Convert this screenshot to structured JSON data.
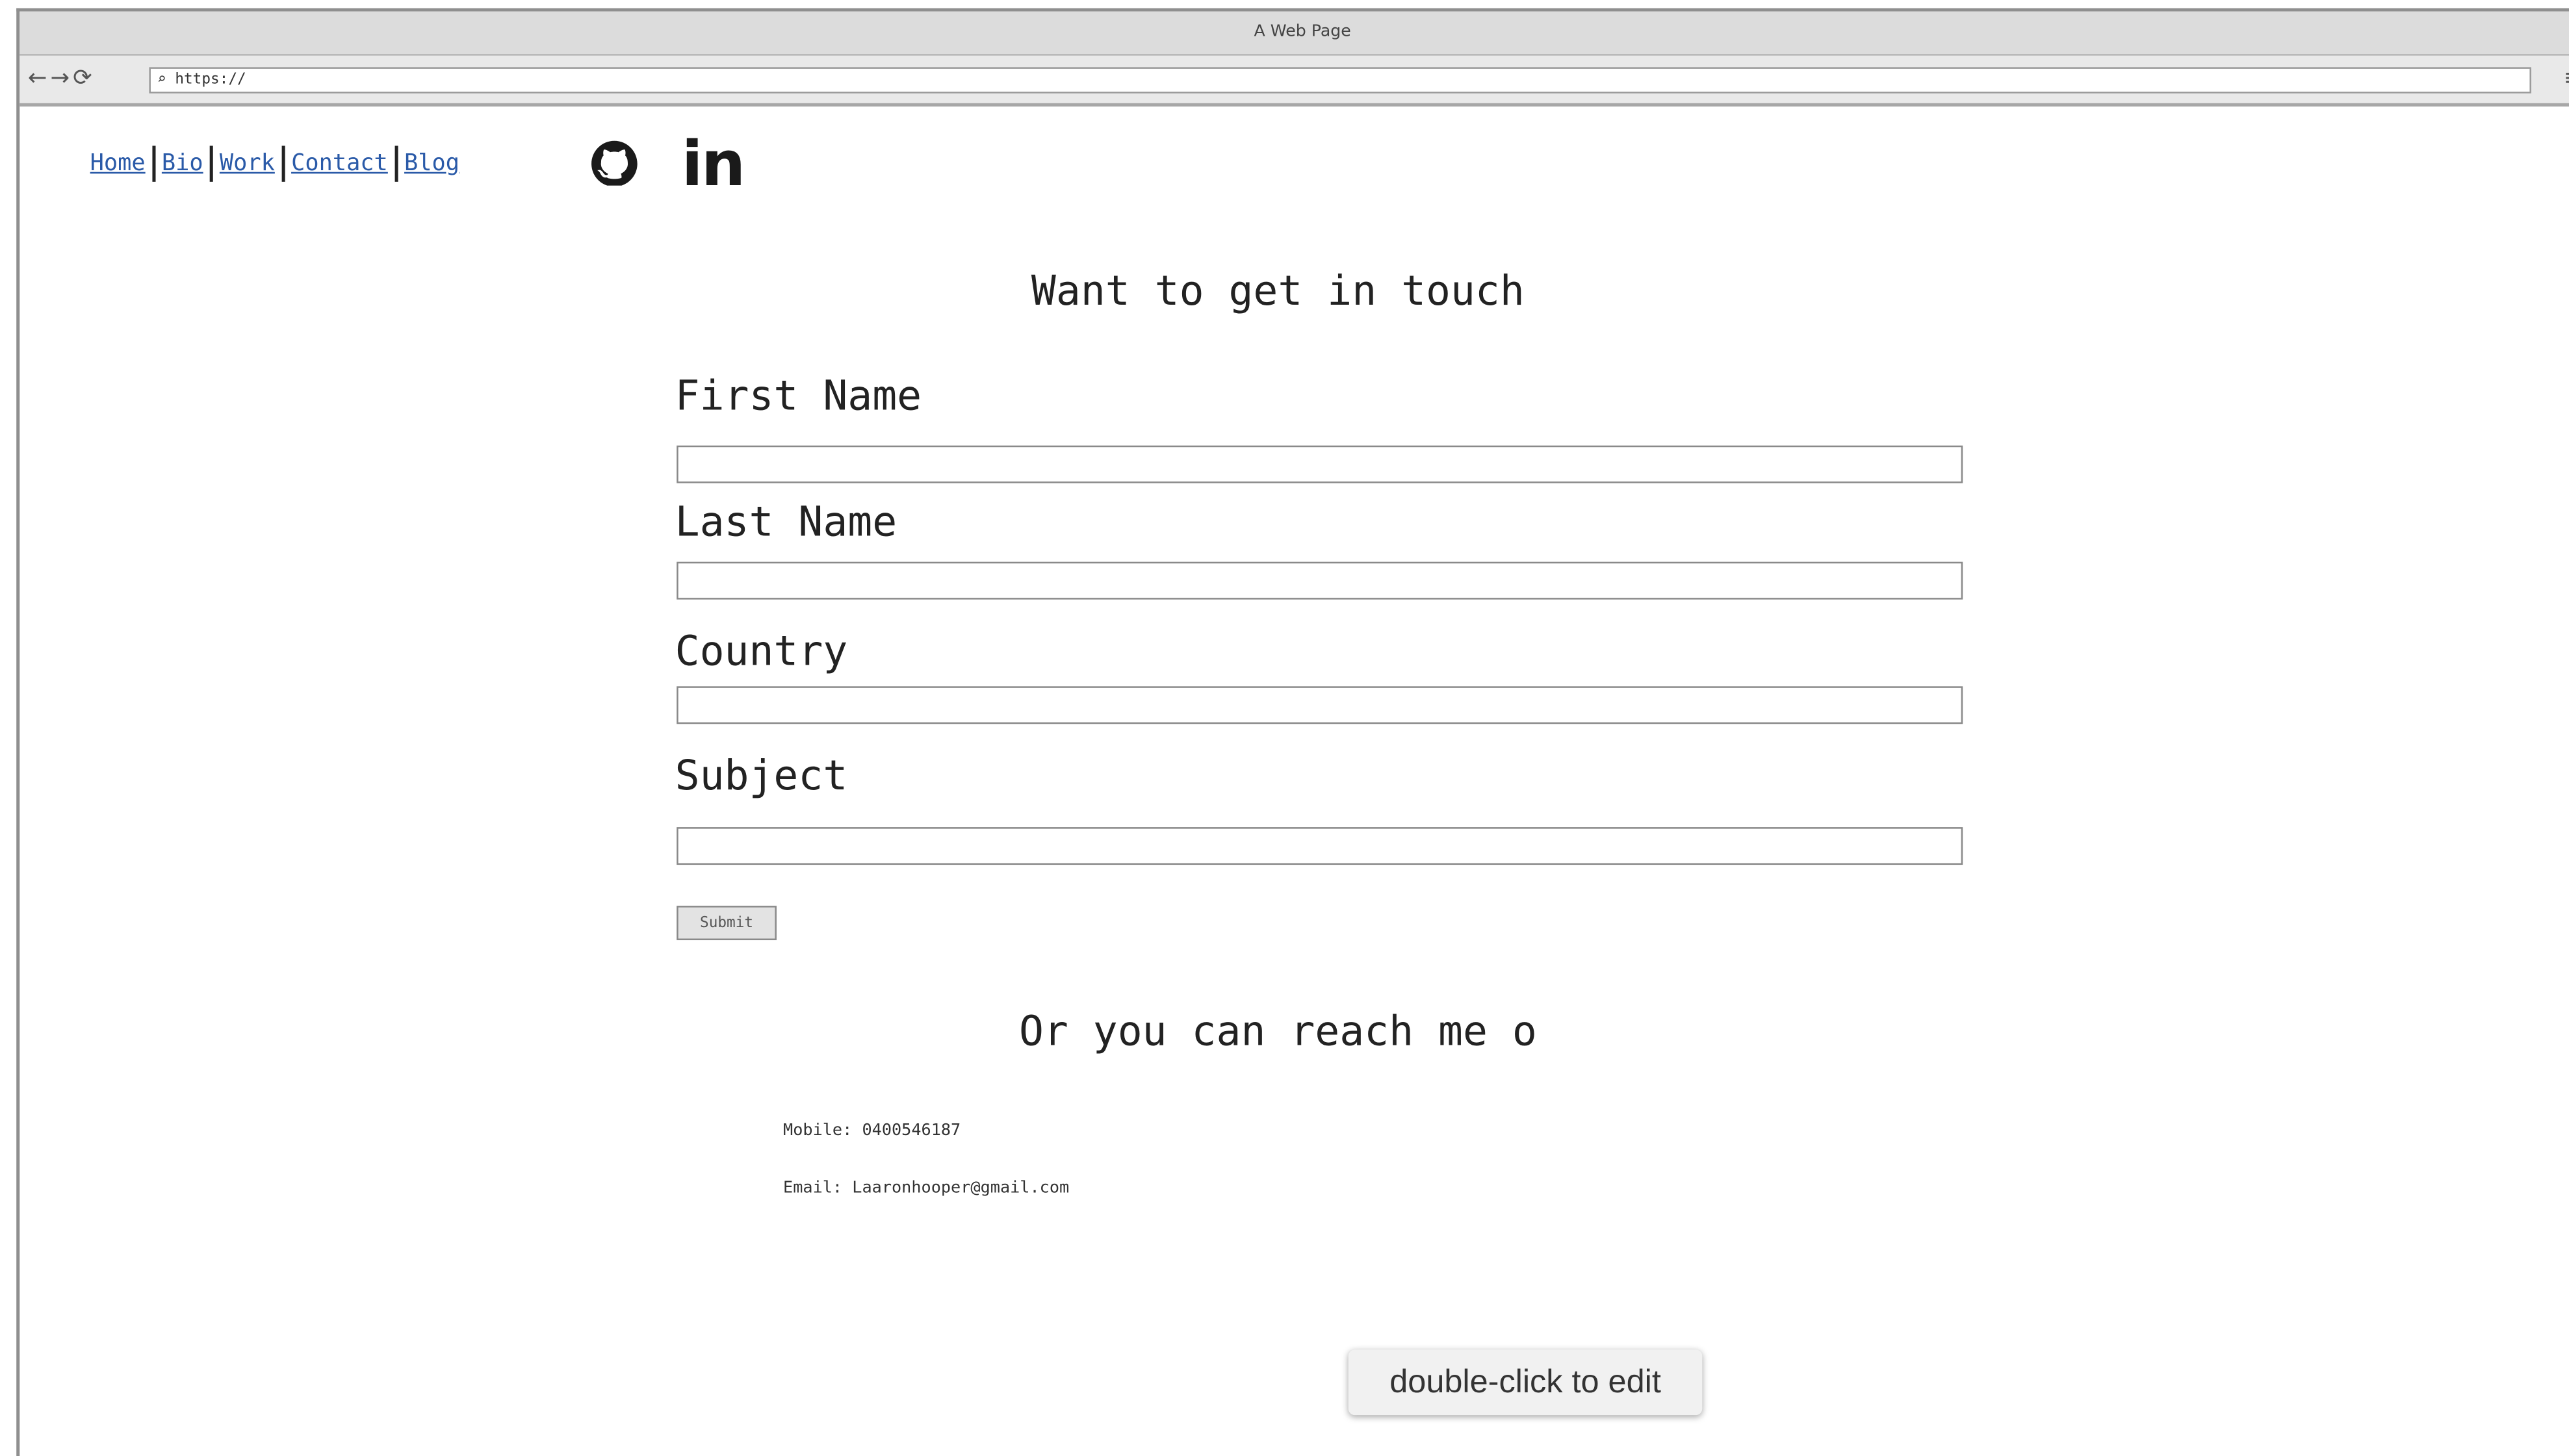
{
  "window": {
    "title": "A Web Page",
    "url": "https://",
    "nav_icons": [
      "back-icon",
      "forward-icon",
      "reload-icon"
    ],
    "search_icon": "search-icon",
    "menu_icon": "menu-icon"
  },
  "nav": {
    "links": [
      "Home",
      "Bio",
      "Work",
      "Contact",
      "Blog"
    ],
    "link_color": "#2a5aa8"
  },
  "social": {
    "github_icon": "github-icon",
    "linkedin_label": "in"
  },
  "form": {
    "heading": "Want to get in touch",
    "fields": [
      {
        "label": "First Name",
        "value": ""
      },
      {
        "label": "Last Name",
        "value": ""
      },
      {
        "label": "Country",
        "value": ""
      },
      {
        "label": "Subject",
        "value": ""
      }
    ],
    "submit_label": "Submit"
  },
  "contact": {
    "heading": "Or you can reach me o",
    "mobile": "Mobile: 0400546187",
    "email": "Email: Laaronhooper@gmail.com"
  },
  "tooltip": "double-click to edit"
}
